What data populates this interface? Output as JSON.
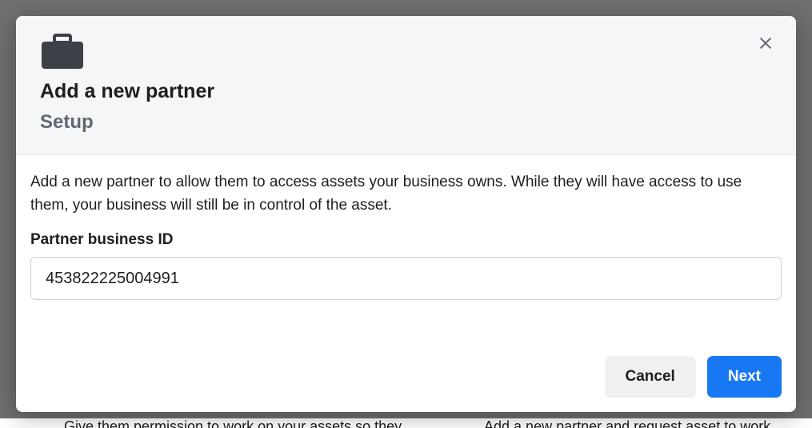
{
  "backdrop": {
    "col1": "Give them permission to work on your assets so they",
    "col2": "Add a new partner and request asset to work"
  },
  "modal": {
    "title": "Add a new partner",
    "subtitle": "Setup",
    "description": "Add a new partner to allow them to access assets your business owns. While they will have access to use them, your business will still be in control of the asset.",
    "field_label": "Partner business ID",
    "input_value": "453822225004991",
    "cancel_label": "Cancel",
    "next_label": "Next"
  }
}
